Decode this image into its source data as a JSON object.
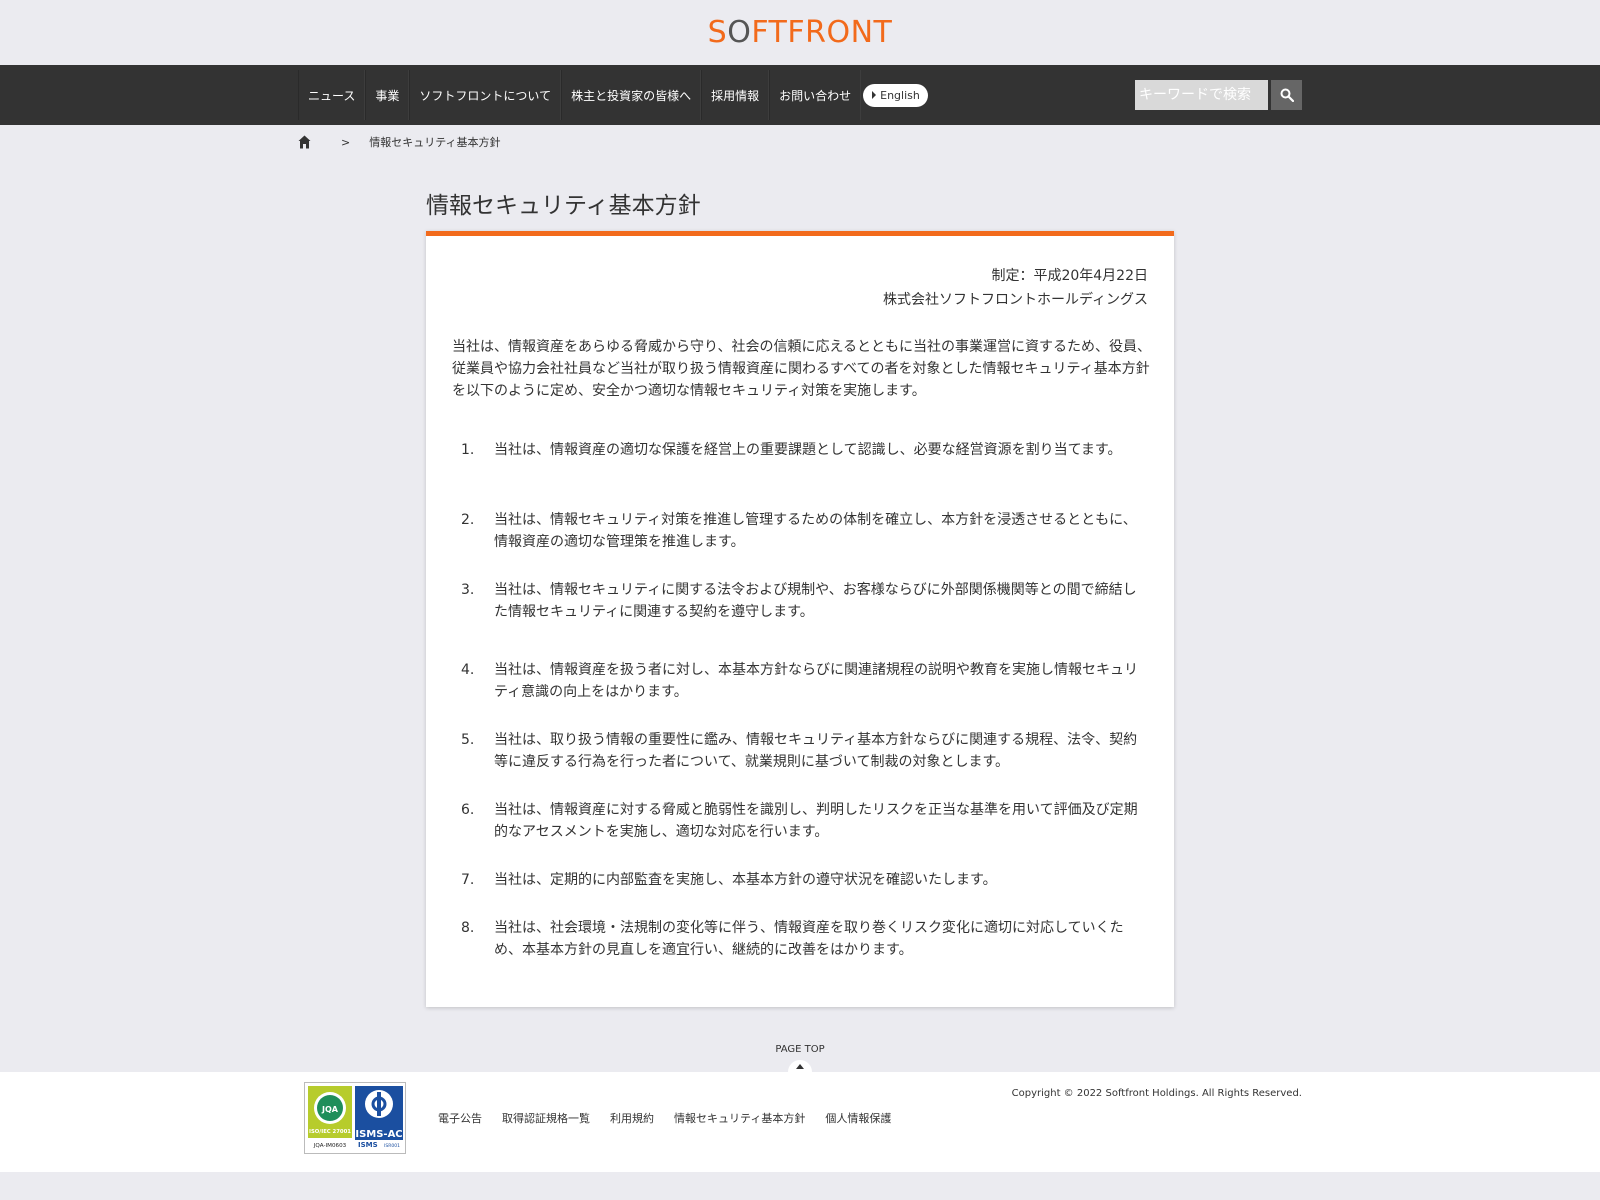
{
  "logo": {
    "text_before": "S",
    "text_o": "O",
    "text_after": "FTFRONT"
  },
  "nav": {
    "items": [
      "ニュース",
      "事業",
      "ソフトフロントについて",
      "株主と投資家の皆様へ",
      "採用情報",
      "お問い合わせ"
    ],
    "english_label": "English"
  },
  "search": {
    "placeholder": "キーワードで検索"
  },
  "breadcrumb": {
    "separator": ">",
    "current": "情報セキュリティ基本方針"
  },
  "page": {
    "title": "情報セキュリティ基本方針",
    "established": "制定：平成20年4月22日",
    "company": "株式会社ソフトフロントホールディングス",
    "intro": "当社は、情報資産をあらゆる脅威から守り、社会の信頼に応えるとともに当社の事業運営に資するため、役員、従業員や協力会社社員など当社が取り扱う情報資産に関わるすべての者を対象とした情報セキュリティ基本方針を以下のように定め、安全かつ適切な情報セキュリティ対策を実施します。",
    "items": [
      {
        "num": "1.",
        "text": "当社は、情報資産の適切な保護を経営上の重要課題として認識し、必要な経営資源を割り当てます。"
      },
      {
        "num": "2.",
        "text": "当社は、情報セキュリティ対策を推進し管理するための体制を確立し、本方針を浸透させるとともに、情報資産の適切な管理策を推進します。"
      },
      {
        "num": "3.",
        "text": "当社は、情報セキュリティに関する法令および規制や、お客様ならびに外部関係機関等との間で締結した情報セキュリティに関連する契約を遵守します。"
      },
      {
        "num": "4.",
        "text": "当社は、情報資産を扱う者に対し、本基本方針ならびに関連諸規程の説明や教育を実施し情報セキュリティ意識の向上をはかります。"
      },
      {
        "num": "5.",
        "text": "当社は、取り扱う情報の重要性に鑑み、情報セキュリティ基本方針ならびに関連する規程、法令、契約等に違反する行為を行った者について、就業規則に基づいて制裁の対象とします。"
      },
      {
        "num": "6.",
        "text": "当社は、情報資産に対する脅威と脆弱性を識別し、判明したリスクを正当な基準を用いて評価及び定期的なアセスメントを実施し、適切な対応を行います。"
      },
      {
        "num": "7.",
        "text": "当社は、定期的に内部監査を実施し、本基本方針の遵守状況を確認いたします。"
      },
      {
        "num": "8.",
        "text": "当社は、社会環境・法規制の変化等に伴う、情報資産を取り巻くリスク変化に適切に対応していくため、本基本方針の見直しを適宜行い、継続的に改善をはかります。"
      }
    ]
  },
  "page_top": "PAGE TOP",
  "footer": {
    "links": [
      "電子公告",
      "取得認証規格一覧",
      "利用規約",
      "情報セキュリティ基本方針",
      "個人情報保護"
    ],
    "copyright": "Copyright © 2022 Softfront Holdings. All Rights Reserved.",
    "badge_jqa_text": "ISO/IEC 27001",
    "badge_jqa_code": "JQA-IM0603",
    "badge_jqa_logo": "JQA",
    "badge_isms_text": "ISMS-AC",
    "badge_isms_sub": "ISMS",
    "badge_isms_std": "ISR001"
  },
  "colors": {
    "accent": "#f26a1b",
    "nav_bg": "#333333",
    "page_bg": "#ebebf0"
  }
}
